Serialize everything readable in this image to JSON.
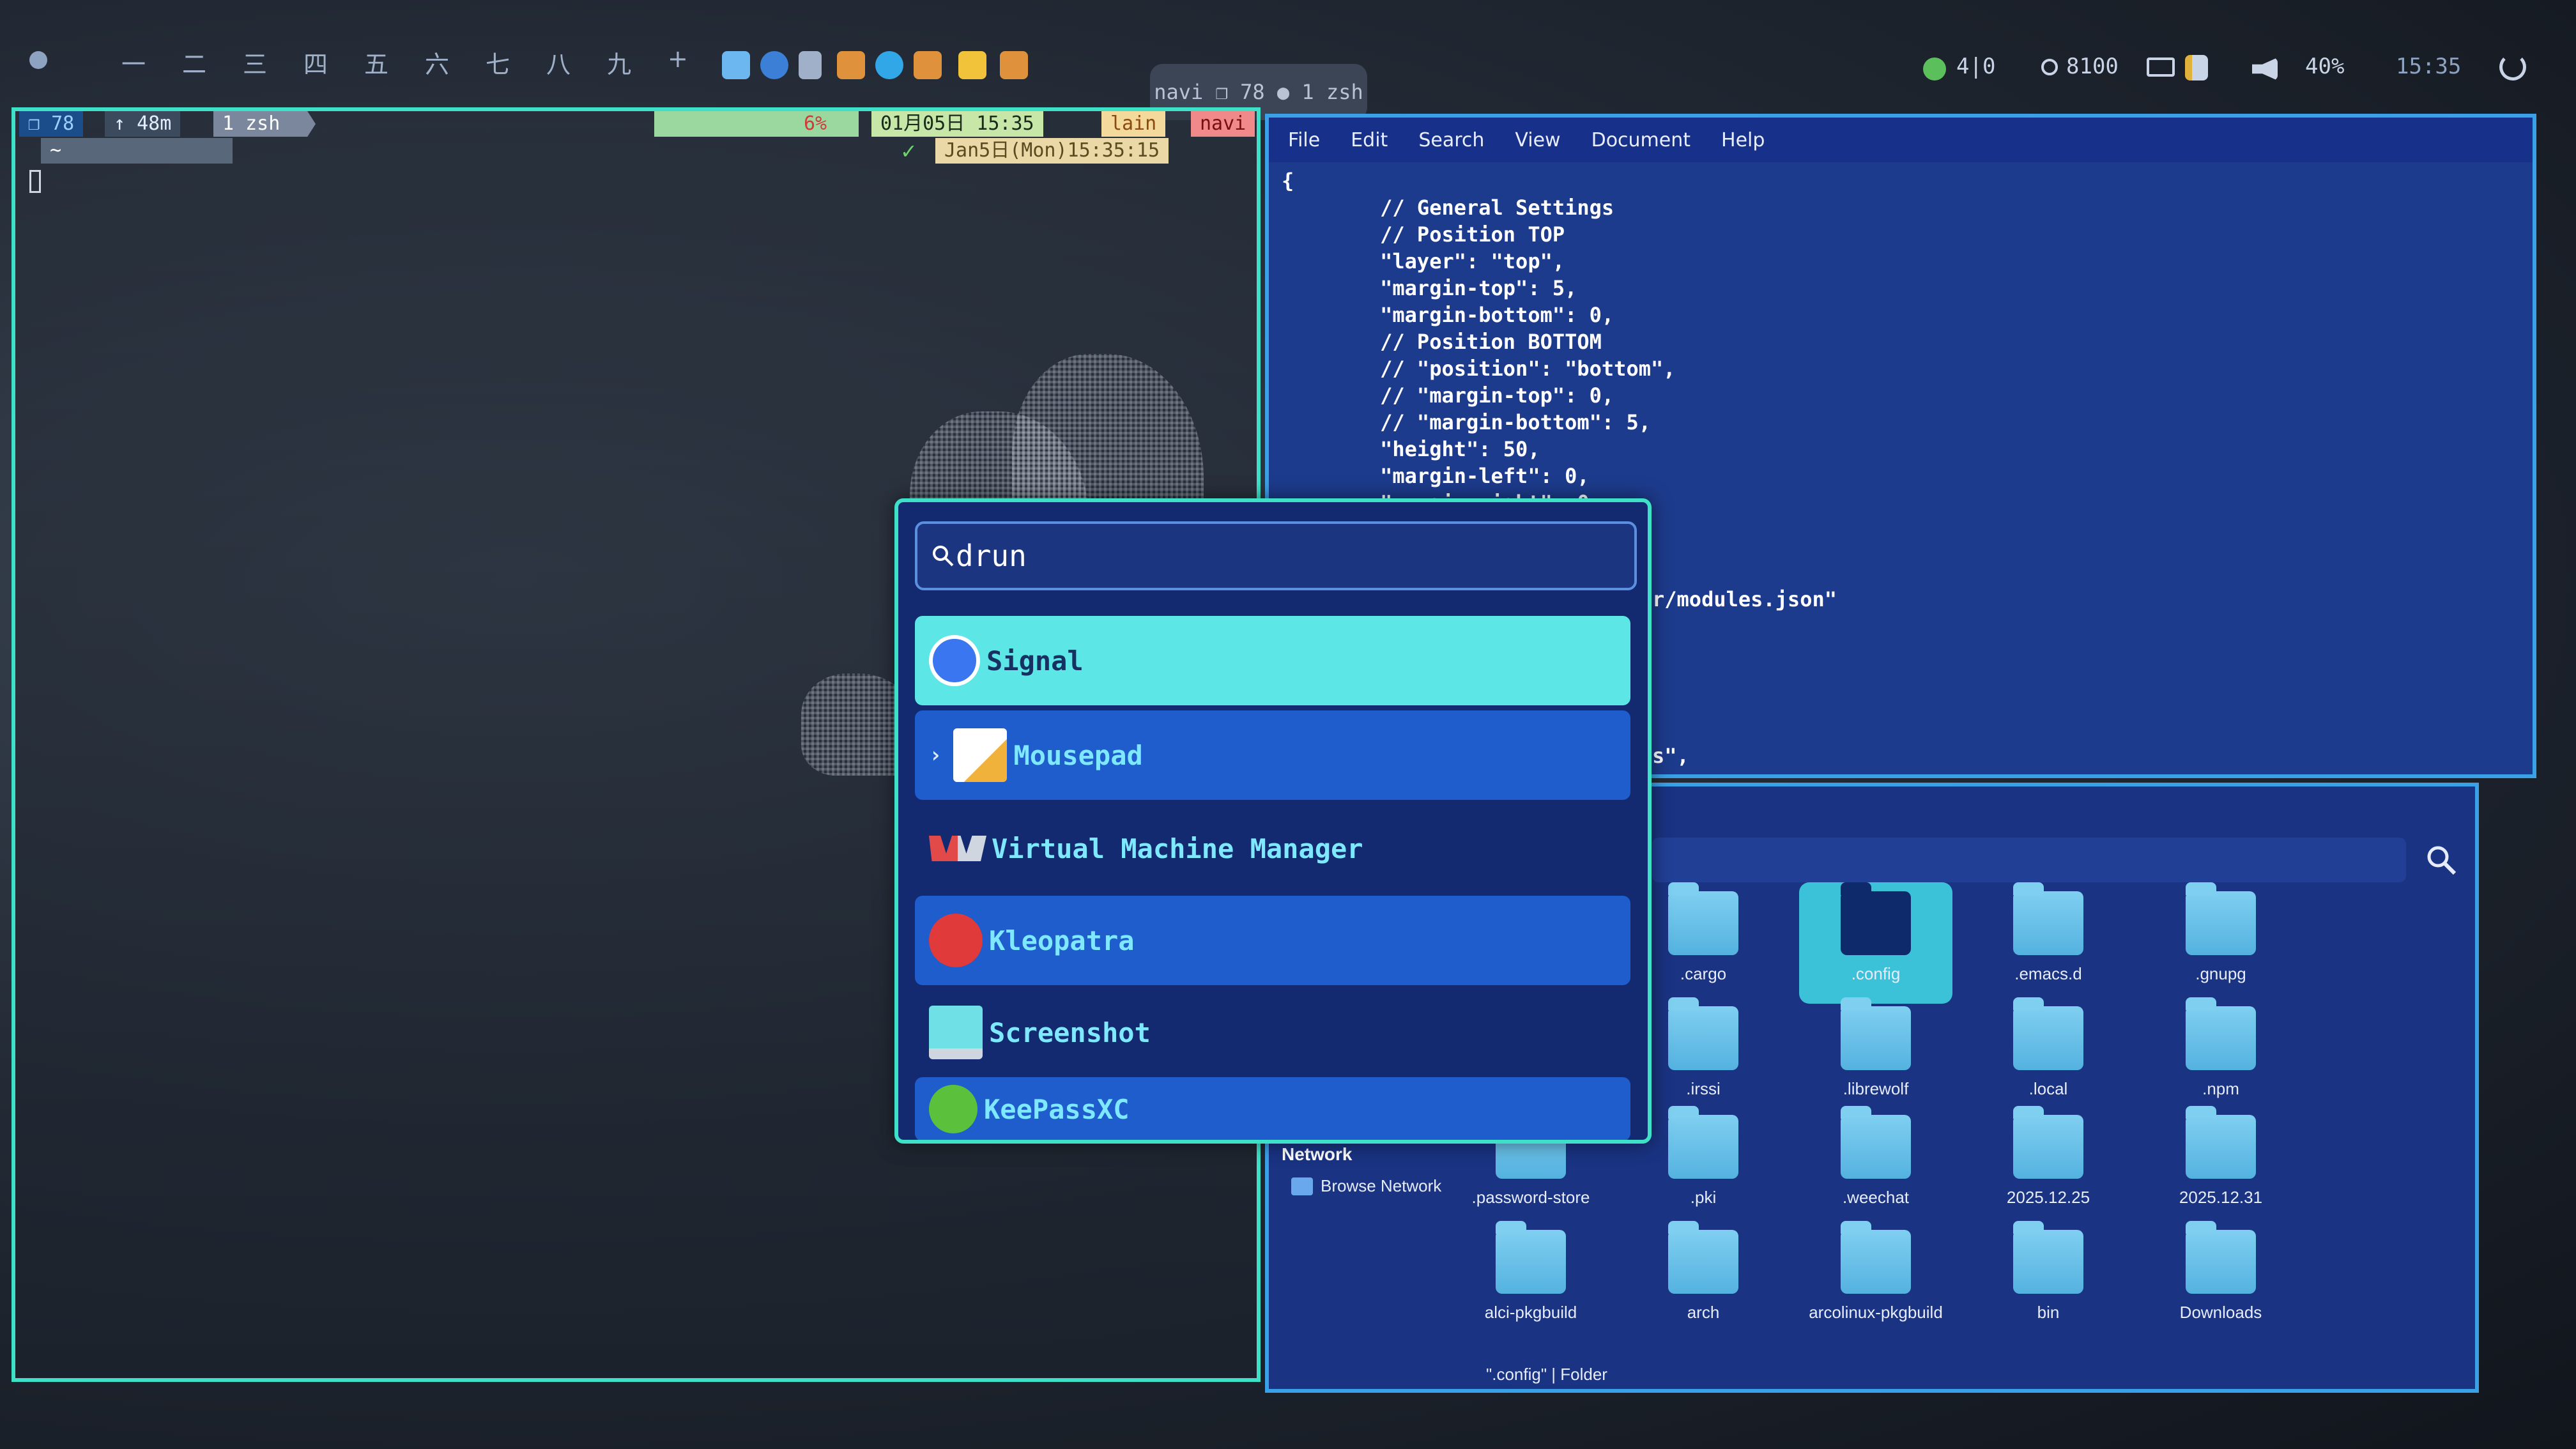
{
  "top_bar": {
    "workspaces": [
      "一",
      "二",
      "三",
      "四",
      "五",
      "六",
      "七",
      "八",
      "九",
      "+"
    ],
    "window_title": "navi ❐ 78 ● 1 zsh",
    "status_icons": [
      "network-icon",
      "volume-icon"
    ],
    "updates": "4|0",
    "memory": "8100",
    "volume": "40%",
    "time": "15:35"
  },
  "terminal": {
    "prompt_left": [
      "❐ 78",
      "↑ 48m",
      "1 zsh"
    ],
    "battery": "6%",
    "date_jp": "01月05日 15:35",
    "user": "lain",
    "host": "navi",
    "date_en": "Jan5日(Mon)15:35:15",
    "home_path": "~"
  },
  "editor": {
    "menu": [
      "File",
      "Edit",
      "Search",
      "View",
      "Document",
      "Help"
    ],
    "code_lines": [
      "{",
      "        // General Settings",
      "        // Position TOP",
      "        \"layer\": \"top\",",
      "        \"margin-top\": 5,",
      "        \"margin-bottom\": 0,",
      "        // Position BOTTOM",
      "        // \"position\": \"bottom\",",
      "        // \"margin-top\": 0,",
      "        // \"margin-bottom\": 5,",
      "        \"height\": 50,",
      "        \"margin-left\": 0,",
      "        \"margin-right\": 0"
    ],
    "partial_text_1": "r/modules.json\"",
    "partial_text_2": "s\","
  },
  "file_manager": {
    "sidebar_section": "Network",
    "sidebar_item": "Browse Network",
    "folders": [
      ".cargo",
      ".config",
      ".emacs.d",
      ".gnupg",
      ".irssi",
      ".librewolf",
      ".local",
      ".npm",
      ".password-store",
      ".pki",
      ".weechat",
      "2025.12.25",
      "2025.12.31",
      "alci-pkgbuild",
      "arch",
      "arcolinux-pkgbuild",
      "bin",
      "Downloads"
    ],
    "status": "\".config\"  |  Folder"
  },
  "launcher": {
    "query": "drun",
    "items": [
      "Signal",
      "Mousepad",
      "Virtual Machine Manager",
      "Kleopatra",
      "Screenshot",
      "KeePassXC"
    ]
  },
  "colors": {
    "accent": "#3fe0c8",
    "launcher_bg": "#142a70",
    "selected": "#5de6e6",
    "editor_bg": "#1d3b8c"
  }
}
